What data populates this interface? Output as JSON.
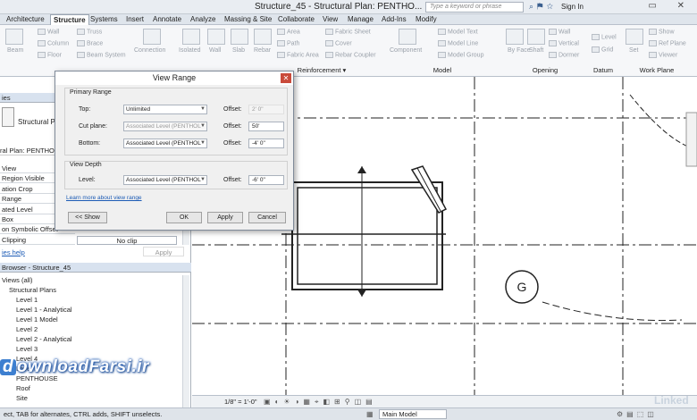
{
  "window": {
    "title": "Structure_45 - Structural Plan: PENTHO...",
    "search_placeholder": "Type a keyword or phrase",
    "sign_in": "Sign In",
    "controls": "▭ ✕"
  },
  "tabs": [
    "Architecture",
    "Structure",
    "Systems",
    "Insert",
    "Annotate",
    "Analyze",
    "Massing & Site",
    "Collaborate",
    "View",
    "Manage",
    "Add-Ins",
    "Modify"
  ],
  "active_tab": "Structure",
  "ribbon": {
    "structure_tools": [
      "Beam",
      "Wall",
      "Column",
      "Floor",
      "Truss",
      "Brace",
      "Beam System"
    ],
    "connection": "Connection",
    "foundation_tools": [
      "Isolated",
      "Wall",
      "Slab"
    ],
    "rebar_tools": [
      "Rebar",
      "Area",
      "Path",
      "Fabric Area",
      "Fabric Sheet",
      "Cover",
      "Rebar Coupler"
    ],
    "component": "Component",
    "model_tools": [
      "Model Text",
      "Model Line",
      "Model Group"
    ],
    "opening_tools": [
      "By Face",
      "Shaft",
      "Wall",
      "Vertical",
      "Dormer"
    ],
    "datum_tools": [
      "Level",
      "Grid"
    ],
    "workplane_tools": [
      "Set",
      "Show",
      "Ref Plane",
      "Viewer"
    ],
    "panels": [
      "Reinforcement",
      "Model",
      "Opening",
      "Datum",
      "Work Plane"
    ]
  },
  "properties": {
    "header": "ies",
    "type_name": "Structural Plan",
    "selector": "ral Plan: PENTHOUSE",
    "rows": [
      {
        "label": "View",
        "value": ""
      },
      {
        "label": "Region Visible",
        "value": ""
      },
      {
        "label": "ation Crop",
        "value": ""
      },
      {
        "label": "Range",
        "value": ""
      },
      {
        "label": "ated Level",
        "value": ""
      },
      {
        "label": "Box",
        "value": ""
      },
      {
        "label": "on Symbolic Offset",
        "value": ""
      },
      {
        "label": "Clipping",
        "value": "No clip"
      }
    ],
    "help_link": "ies help",
    "apply_label": "Apply"
  },
  "browser": {
    "header": "Browser - Structure_45",
    "items": [
      {
        "label": "Views (all)",
        "indent": 0
      },
      {
        "label": "Structural Plans",
        "indent": 1
      },
      {
        "label": "Level 1",
        "indent": 2
      },
      {
        "label": "Level 1 - Analytical",
        "indent": 2
      },
      {
        "label": "Level 1 Model",
        "indent": 2
      },
      {
        "label": "Level 2",
        "indent": 2
      },
      {
        "label": "Level 2 - Analytical",
        "indent": 2
      },
      {
        "label": "Level 3",
        "indent": 2
      },
      {
        "label": "Level 4",
        "indent": 2
      },
      {
        "label": "Level 5",
        "indent": 2
      },
      {
        "label": "PENTHOUSE",
        "indent": 2
      },
      {
        "label": "Roof",
        "indent": 2
      },
      {
        "label": "Site",
        "indent": 2
      }
    ]
  },
  "dialog": {
    "title": "View Range",
    "close": "✕",
    "primary_range": "Primary Range",
    "top_label": "Top:",
    "top_value": "Unlimited",
    "top_offset_label": "Offset:",
    "top_offset": "2' 0\"",
    "cut_label": "Cut plane:",
    "cut_value": "Associated Level (PENTHOL",
    "cut_offset_label": "Offset:",
    "cut_offset": "50'",
    "bottom_label": "Bottom:",
    "bottom_value": "Associated Level (PENTHOL",
    "bottom_offset_label": "Offset:",
    "bottom_offset": "-4' 0\"",
    "view_depth": "View Depth",
    "level_label": "Level:",
    "level_value": "Associated Level (PENTHOL",
    "level_offset_label": "Offset:",
    "level_offset": "-6' 0\"",
    "learn_more": "Learn more about view range",
    "show_button": "<< Show",
    "ok_button": "OK",
    "apply_button": "Apply",
    "cancel_button": "Cancel"
  },
  "canvas": {
    "grid_bubble": "G"
  },
  "viewbar": {
    "scale": "1/8\" = 1'-0\""
  },
  "status": {
    "message": "ect, TAB for alternates, CTRL adds, SHIFT unselects.",
    "workset": "Main Model"
  },
  "watermark": {
    "logo_letter": "d",
    "text": "ownloadFarsi.ir"
  },
  "linkedin": "Linked"
}
